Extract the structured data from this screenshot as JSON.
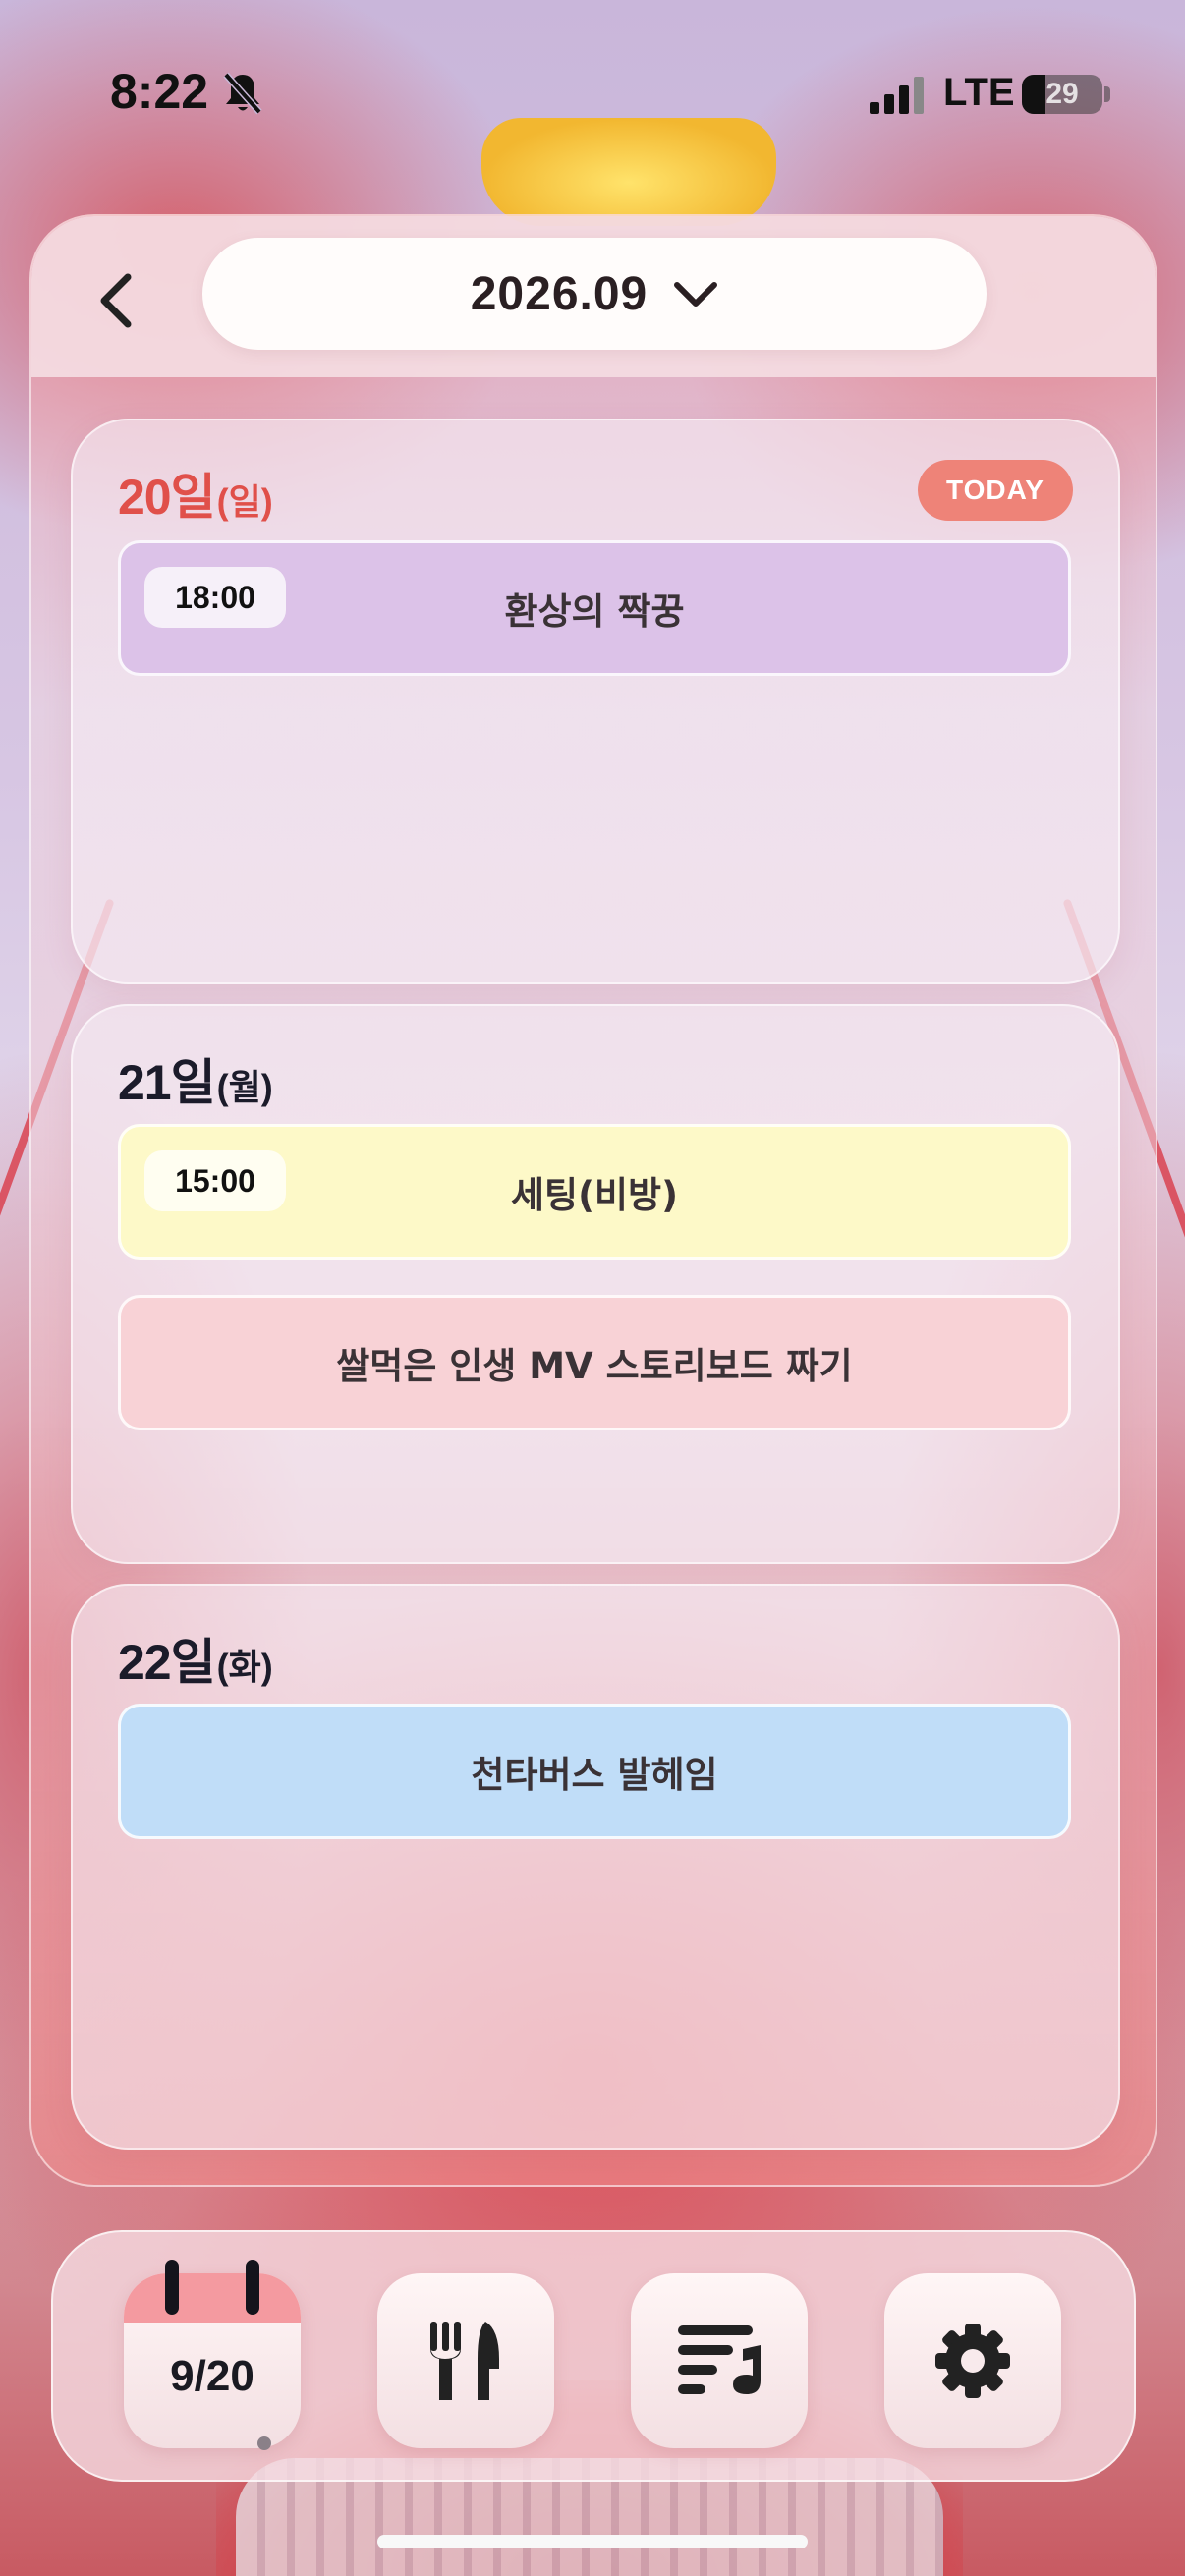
{
  "status_bar": {
    "time": "8:22",
    "network": "LTE",
    "battery_percent": 29
  },
  "header": {
    "month": "2026.09",
    "back_icon": "chevron-left-icon",
    "dropdown_icon": "chevron-down-icon"
  },
  "days": [
    {
      "day": "20일",
      "weekday": "(일)",
      "badge": "TODAY",
      "color": "#e0504a",
      "events": [
        {
          "time": "18:00",
          "title": "환상의 짝꿍",
          "color": "#dcc2e8"
        }
      ]
    },
    {
      "day": "21일",
      "weekday": "(월)",
      "color": "#1b1b2a",
      "events": [
        {
          "time": "15:00",
          "title": "세팅(비방)",
          "color": "#fdf9c8"
        },
        {
          "title": "쌀먹은 인생 MV 스토리보드 짜기",
          "color": "#f8d2d6"
        }
      ]
    },
    {
      "day": "22일",
      "weekday": "(화)",
      "color": "#1b1b2a",
      "events": [
        {
          "title": "천타버스 발헤임",
          "color": "#c0ddf8"
        }
      ]
    }
  ],
  "bottom_nav": {
    "calendar_date": "9/20",
    "items": [
      "calendar-icon",
      "utensils-icon",
      "music-list-icon",
      "gear-icon"
    ]
  }
}
